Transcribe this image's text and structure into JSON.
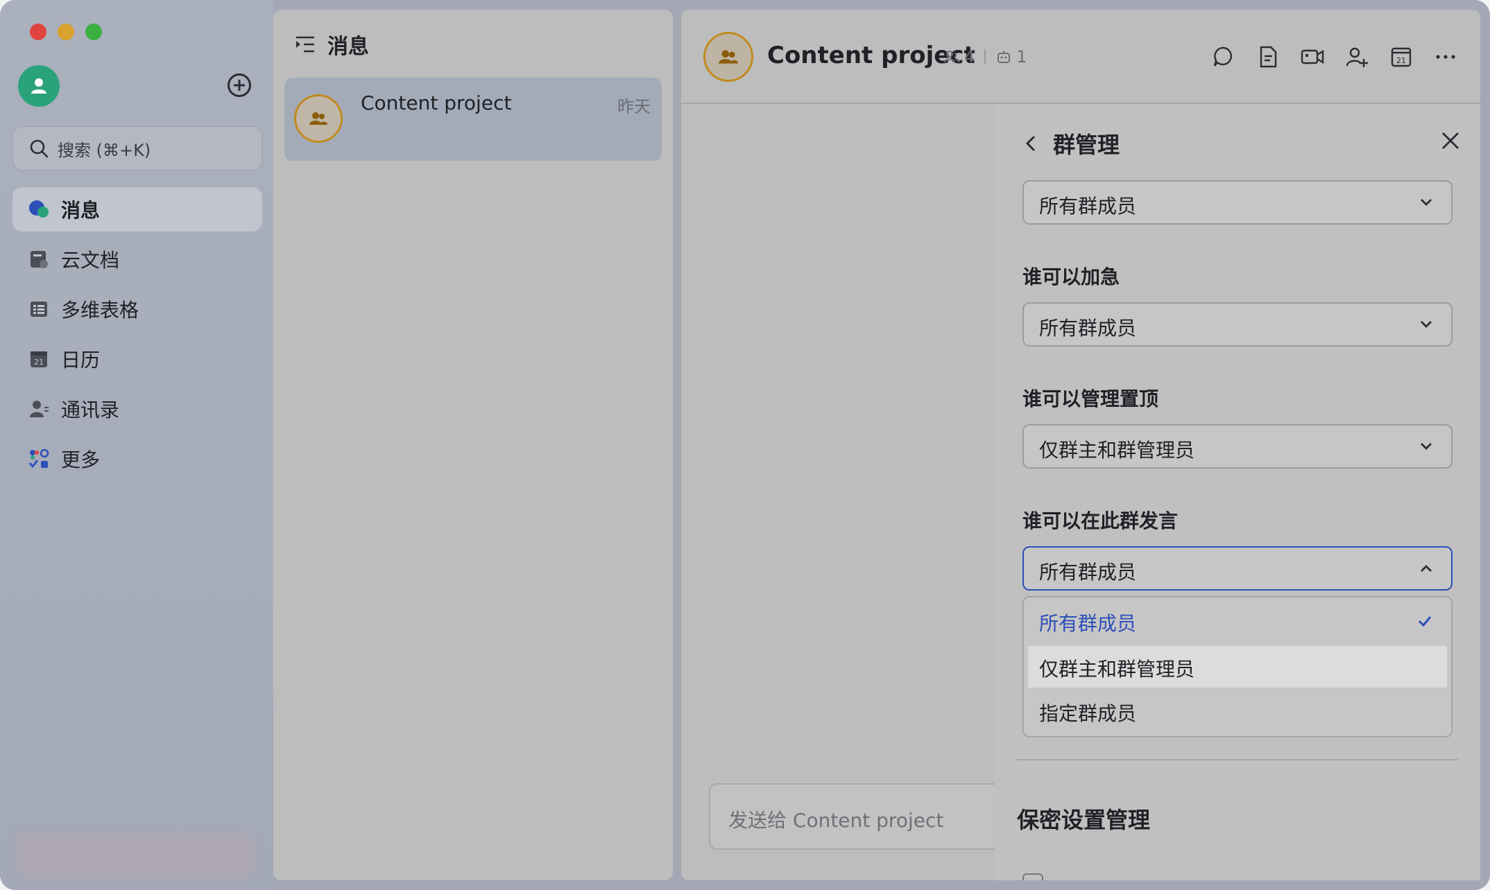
{
  "sidebar": {
    "search_placeholder": "搜索 (⌘+K)",
    "items": [
      {
        "label": "消息",
        "icon": "chat-bubble-icon",
        "active": true
      },
      {
        "label": "云文档",
        "icon": "cloud-doc-icon",
        "active": false
      },
      {
        "label": "多维表格",
        "icon": "table-icon",
        "active": false
      },
      {
        "label": "日历",
        "icon": "calendar-icon",
        "active": false
      },
      {
        "label": "通讯录",
        "icon": "contacts-icon",
        "active": false
      },
      {
        "label": "更多",
        "icon": "apps-grid-icon",
        "active": false
      }
    ]
  },
  "msglist": {
    "title": "消息",
    "conversations": [
      {
        "title": "Content project",
        "time": "昨天"
      }
    ]
  },
  "chat": {
    "title": "Content project",
    "member_count": "4",
    "bot_count": "1",
    "composer_placeholder": "发送给 Content project"
  },
  "panel": {
    "title": "群管理",
    "top_select_value": "所有群成员",
    "fields": [
      {
        "label": "谁可以加急",
        "value": "所有群成员"
      },
      {
        "label": "谁可以管理置顶",
        "value": "仅群主和群管理员"
      },
      {
        "label": "谁可以在此群发言",
        "value": "所有群成员"
      }
    ],
    "dropdown_options": [
      {
        "label": "所有群成员",
        "selected": true
      },
      {
        "label": "仅群主和群管理员",
        "selected": false
      },
      {
        "label": "指定群成员",
        "selected": false
      }
    ],
    "section_title": "保密设置管理"
  },
  "colors": {
    "accent": "#2d4fb8",
    "avatar_green": "#2aa37b",
    "group_gold": "#c18b1f"
  }
}
